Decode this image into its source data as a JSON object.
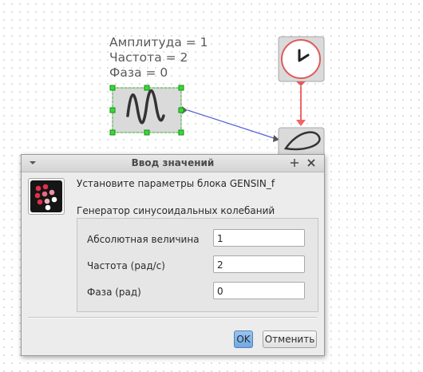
{
  "canvas": {
    "block_label_lines": [
      "Амплитуда = 1",
      "Частота = 2",
      "Фаза = 0"
    ],
    "colors": {
      "link": "#5060d8",
      "clock_link": "#f06464",
      "selection": "#22bb22"
    },
    "icons": [
      "sine-wave-icon",
      "clock-icon",
      "scope-icon"
    ]
  },
  "dialog": {
    "title": "Ввод значений",
    "titlebar_icons": [
      "menu-arrow-icon",
      "pin-icon",
      "close-icon"
    ],
    "prompt": "Установите параметры блока GENSIN_f",
    "subtitle": "Генератор синусоидальных колебаний",
    "fields": [
      {
        "label": "Абсолютная величина",
        "value": "1"
      },
      {
        "label": "Частота (рад/с)",
        "value": "2"
      },
      {
        "label": "Фаза (рад)",
        "value": "0"
      }
    ],
    "ok_label": "OK",
    "cancel_label": "Отменить",
    "accent": "#7aaee2"
  }
}
